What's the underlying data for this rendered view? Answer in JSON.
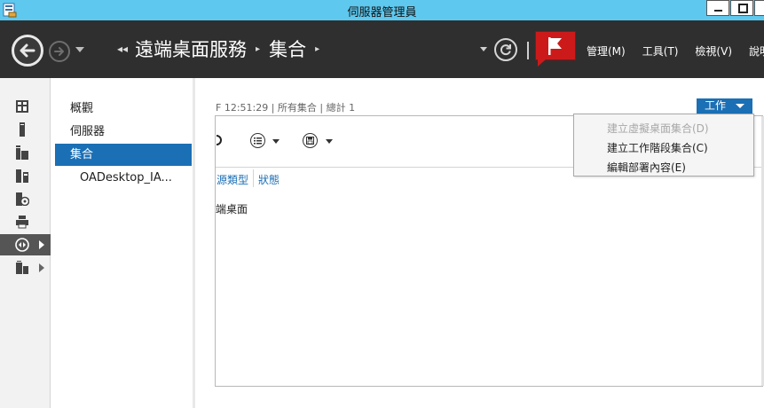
{
  "window": {
    "title": "伺服器管理員"
  },
  "nav": {
    "breadcrumb_prefix": "◂◂",
    "breadcrumbs": [
      "遠端桌面服務",
      "集合"
    ],
    "separator": "▸",
    "menus": [
      "管理(M)",
      "工具(T)",
      "檢視(V)",
      "說明("
    ]
  },
  "leftbar": {
    "items": [
      {
        "icon": "dashboard-icon"
      },
      {
        "icon": "local-server-icon"
      },
      {
        "icon": "all-servers-icon"
      },
      {
        "icon": "file-storage-icon"
      },
      {
        "icon": "iis-icon"
      },
      {
        "icon": "print-services-icon"
      },
      {
        "icon": "remote-desktop-icon",
        "active": true
      },
      {
        "icon": "wsus-icon"
      }
    ]
  },
  "navpane": {
    "items": [
      {
        "label": "概觀"
      },
      {
        "label": "伺服器"
      },
      {
        "label": "集合",
        "selected": true
      },
      {
        "label": "OADesktop_IA...",
        "sub": true
      }
    ]
  },
  "content": {
    "status_line": "F 12:51:29 | 所有集合 | 總計 1",
    "tasks_label": "工作",
    "columns": [
      "源類型",
      "狀態"
    ],
    "row_cell": "端桌面"
  },
  "tasks_menu": {
    "items": [
      {
        "label": "建立虛擬桌面集合(D)",
        "enabled": false
      },
      {
        "label": "建立工作階段集合(C)",
        "enabled": true
      },
      {
        "label": "編輯部署內容(E)",
        "enabled": true
      }
    ]
  },
  "colors": {
    "titlebar": "#5ec8ee",
    "navbar": "#2f2f2f",
    "accent": "#1b6fb5",
    "flag": "#cc1a1a"
  }
}
